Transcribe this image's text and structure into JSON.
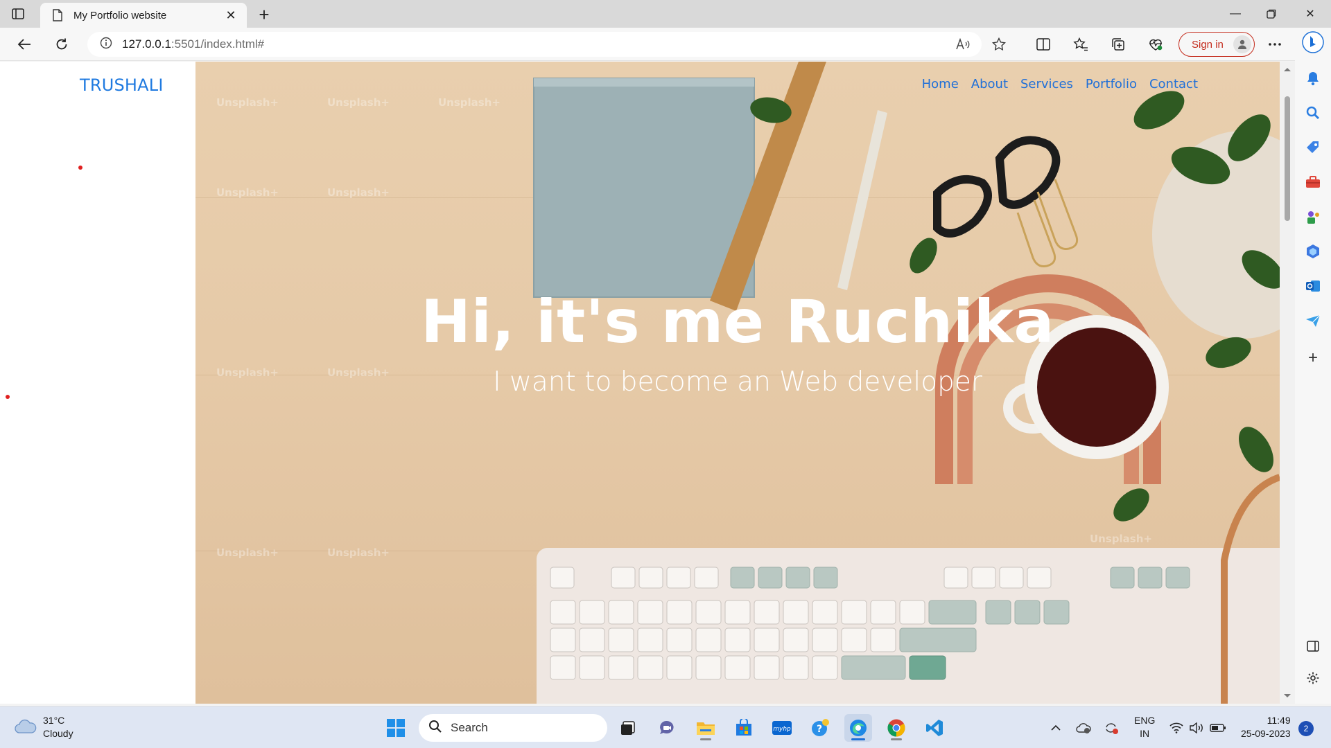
{
  "browser": {
    "tab_title": "My Portfolio website",
    "url_host": "127.0.0.1",
    "url_rest": ":5501/index.html#",
    "signin_label": "Sign in"
  },
  "page": {
    "brand": "TRUSHALI",
    "nav": [
      "Home",
      "About",
      "Services",
      "Portfolio",
      "Contact"
    ],
    "hero_title": "Hi, it's me Ruchika",
    "hero_subtitle": "I want to become an Web developer",
    "watermark": "Unsplash+"
  },
  "taskbar": {
    "weather_temp": "31°C",
    "weather_desc": "Cloudy",
    "search_label": "Search",
    "lang_line1": "ENG",
    "lang_line2": "IN",
    "time": "11:49",
    "date": "25-09-2023",
    "notification_count": "2"
  },
  "colors": {
    "brand": "#1f7ae0",
    "nav_link": "#1f6fd8",
    "signin": "#c42b1c"
  }
}
